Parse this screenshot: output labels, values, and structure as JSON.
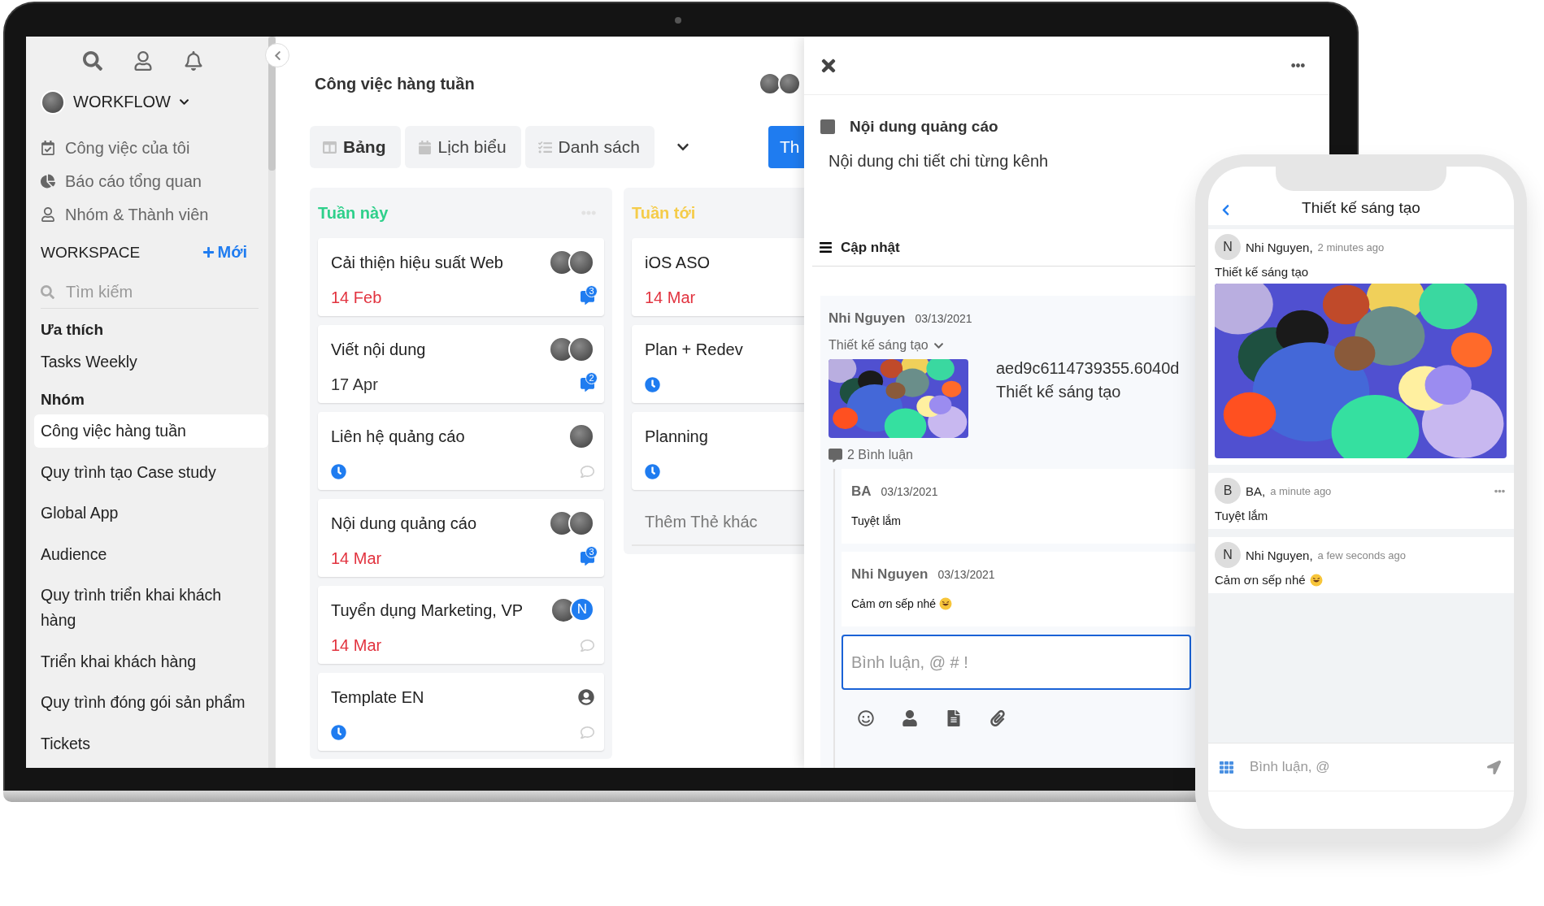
{
  "sidebar": {
    "workspace_name": "WORKFLOW",
    "nav": [
      "Công việc của tôi",
      "Báo cáo tổng quan",
      "Nhóm & Thành viên"
    ],
    "workspace_label": "WORKSPACE",
    "new_button": "Mới",
    "search": {
      "placeholder": "Tìm kiếm"
    },
    "sections": [
      {
        "heading": "Ưa thích",
        "items": [
          {
            "label": "Tasks Weekly",
            "selected": false
          }
        ]
      },
      {
        "heading": "Nhóm",
        "items": [
          {
            "label": "Công việc hàng tuần",
            "selected": true
          },
          {
            "label": "Quy trình tạo Case study",
            "selected": false
          },
          {
            "label": "Global App",
            "selected": false
          },
          {
            "label": "Audience",
            "selected": false
          },
          {
            "label": "Quy trình triển khai khách hàng",
            "selected": false
          },
          {
            "label": "Triển khai khách hàng",
            "selected": false
          },
          {
            "label": "Quy trình đóng gói sản phẩm",
            "selected": false
          },
          {
            "label": "Tickets",
            "selected": false
          }
        ]
      }
    ]
  },
  "board": {
    "title": "Công việc hàng tuần",
    "tabs": [
      {
        "label": "Bảng",
        "selected": true
      },
      {
        "label": "Lịch biểu",
        "selected": false
      },
      {
        "label": "Danh sách",
        "selected": false
      }
    ],
    "primary_button": "Th",
    "columns": [
      {
        "title": "Tuần này",
        "color": "#2fd08b",
        "cards": [
          {
            "title": "Cải thiện hiệu suất Web",
            "date": "14 Feb",
            "overdue": true,
            "assignees": [
              {
                "kind": "photo"
              },
              {
                "kind": "photo"
              }
            ],
            "comment_icon": true,
            "comments": "3"
          },
          {
            "title": "Viết nội dung",
            "date": "17 Apr",
            "overdue": false,
            "assignees": [
              {
                "kind": "photo"
              },
              {
                "kind": "photo"
              }
            ],
            "comment_icon": true,
            "comments": "2"
          },
          {
            "title": "Liên hệ quảng cáo",
            "assignees": [
              {
                "kind": "photo"
              }
            ],
            "comment_icon": true
          },
          {
            "title": "Nội dung quảng cáo",
            "date": "14 Mar",
            "overdue": true,
            "assignees": [
              {
                "kind": "photo"
              },
              {
                "kind": "photo"
              }
            ],
            "comment_icon": true,
            "comments": "3"
          },
          {
            "title": "Tuyển dụng Marketing, VP",
            "date": "14 Mar",
            "overdue": true,
            "assignees": [
              {
                "kind": "photo"
              },
              {
                "kind": "letter",
                "letter": "N"
              }
            ],
            "comment_icon": true
          },
          {
            "title": "Template EN",
            "assignees": [
              {
                "kind": "user"
              }
            ],
            "comment_icon": true
          }
        ]
      },
      {
        "title": "Tuần tới",
        "color": "#f5cc4a",
        "cards": [
          {
            "title": "iOS ASO",
            "date": "14 Mar",
            "overdue": true
          },
          {
            "title": "Plan + Redev"
          },
          {
            "title": "Planning"
          }
        ],
        "add_card": "Thêm Thẻ khác"
      }
    ]
  },
  "detail": {
    "task_title": "Nội dung quảng cáo",
    "description": "Nội dung chi tiết chi từng kênh",
    "updates_heading": "Cập nhật",
    "update": {
      "author": "Nhi Nguyen",
      "date": "03/13/2021",
      "attachment_label": "Thiết kế sáng tạo",
      "file_name": "aed9c6114739355.6040d",
      "file_caption": "Thiết kế sáng tạo",
      "comment_count": "2 Bình luận",
      "comments": [
        {
          "author": "BA",
          "date": "03/13/2021",
          "text": "Tuyệt lắm",
          "emoji": false
        },
        {
          "author": "Nhi Nguyen",
          "date": "03/13/2021",
          "text": "Cảm ơn sếp nhé",
          "emoji": true
        }
      ]
    },
    "comment_input": {
      "placeholder": "Bình luận, @ # !"
    }
  },
  "phone": {
    "title": "Thiết kế sáng tạo",
    "posts": [
      {
        "initial": "N",
        "author": "Nhi Nguyen,",
        "time": "2 minutes ago",
        "text": "Thiết kế sáng tạo",
        "image": true,
        "menu": false,
        "emoji": false
      },
      {
        "initial": "B",
        "author": "BA,",
        "time": "a minute ago",
        "text": "Tuyệt lắm",
        "image": false,
        "menu": true,
        "emoji": false
      },
      {
        "initial": "N",
        "author": "Nhi Nguyen,",
        "time": "a few seconds ago",
        "text": "Cảm ơn sếp nhé",
        "image": false,
        "menu": false,
        "emoji": true
      }
    ],
    "input": {
      "placeholder": "Bình luận, @"
    }
  }
}
